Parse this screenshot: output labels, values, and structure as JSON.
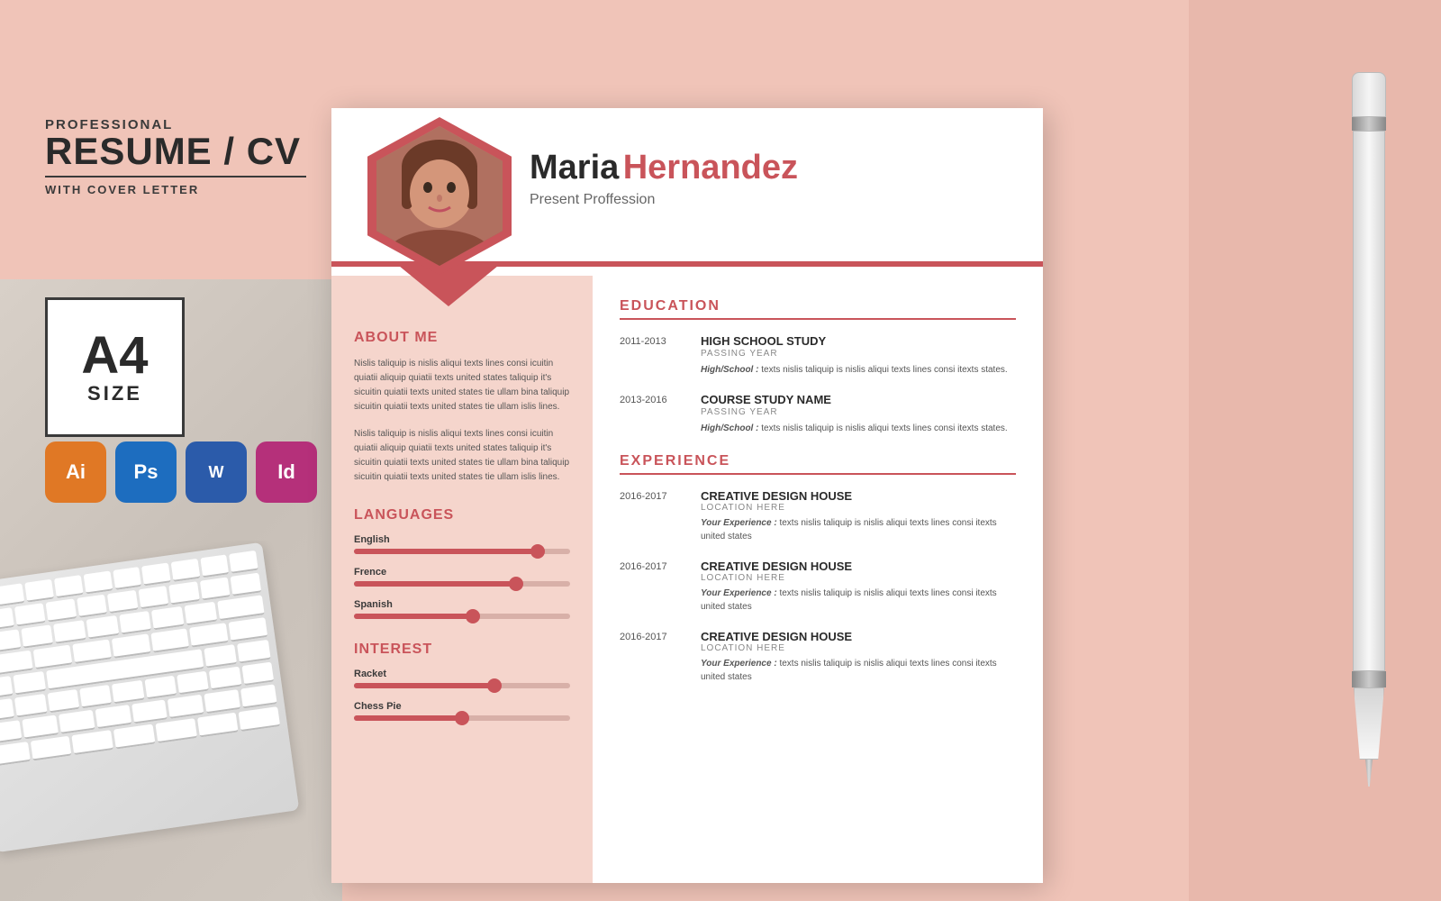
{
  "background": {
    "color": "#f0c4b8"
  },
  "left_panel": {
    "professional": "PROFESSIONAL",
    "resume_cv": "RESUME / CV",
    "with_cover": "WITH COVER LETTER",
    "a4_label": "A4",
    "a4_size": "SIZE",
    "software": [
      {
        "name": "Illustrator",
        "abbr": "Ai",
        "color": "#e07825"
      },
      {
        "name": "Photoshop",
        "abbr": "Ps",
        "color": "#1d6dbf"
      },
      {
        "name": "Word",
        "abbr": "W",
        "color": "#2b5baa"
      },
      {
        "name": "InDesign",
        "abbr": "Id",
        "color": "#b5307a"
      }
    ]
  },
  "resume": {
    "person": {
      "first_name": "Maria",
      "last_name": "Hernandez",
      "profession": "Present Proffession"
    },
    "about_title": "ABOUT ME",
    "about_text_1": "Nislis taliquip is nislis aliqui texts lines consi icuitin quiatii aliquip quiatii texts united states  taliquip it's sicuitin quiatii texts united states tie ullam bina taliquip sicuitin quiatii texts united states tie ullam islis lines.",
    "about_text_2": "Nislis taliquip is nislis aliqui texts lines consi icuitin quiatii aliquip quiatii texts united states  taliquip it's sicuitin quiatii texts united states tie ullam bina taliquip sicuitin quiatii texts united states tie ullam islis lines.",
    "languages_title": "LANGUAGES",
    "languages": [
      {
        "name": "English",
        "pct": 85
      },
      {
        "name": "Frence",
        "pct": 75
      },
      {
        "name": "Spanish",
        "pct": 55
      }
    ],
    "interest_title": "INTEREST",
    "interests": [
      {
        "name": "Racket",
        "pct": 65
      },
      {
        "name": "Chess Pie",
        "pct": 50
      }
    ],
    "education_title": "EDUCATION",
    "education": [
      {
        "years": "2011-2013",
        "degree": "HIGH SCHOOL STUDY",
        "sub": "PASSING YEAR",
        "desc_label": "High/School :",
        "desc": "texts nislis taliquip is nislis aliqui texts lines consi itexts states."
      },
      {
        "years": "2013-2016",
        "degree": "COURSE STUDY NAME",
        "sub": "PASSING YEAR",
        "desc_label": "High/School :",
        "desc": "texts nislis taliquip is nislis aliqui texts lines consi itexts states."
      }
    ],
    "experience_title": "EXPERIENCE",
    "experience": [
      {
        "years": "2016-2017",
        "company": "CREATIVE DESIGN HOUSE",
        "location": "LOCATION HERE",
        "desc_label": "Your Experience :",
        "desc": "texts nislis taliquip is nislis aliqui texts lines consi itexts united states"
      },
      {
        "years": "2016-2017",
        "company": "CREATIVE DESIGN HOUSE",
        "location": "LOCATION HERE",
        "desc_label": "Your Experience :",
        "desc": "texts nislis taliquip is nislis aliqui texts lines consi itexts united states"
      },
      {
        "years": "2016-2017",
        "company": "CREATIVE DESIGN HOUSE",
        "location": "LOCATION HERE",
        "desc_label": "Your Experience :",
        "desc": "texts nislis taliquip is nislis aliqui texts lines consi itexts united states"
      }
    ]
  }
}
